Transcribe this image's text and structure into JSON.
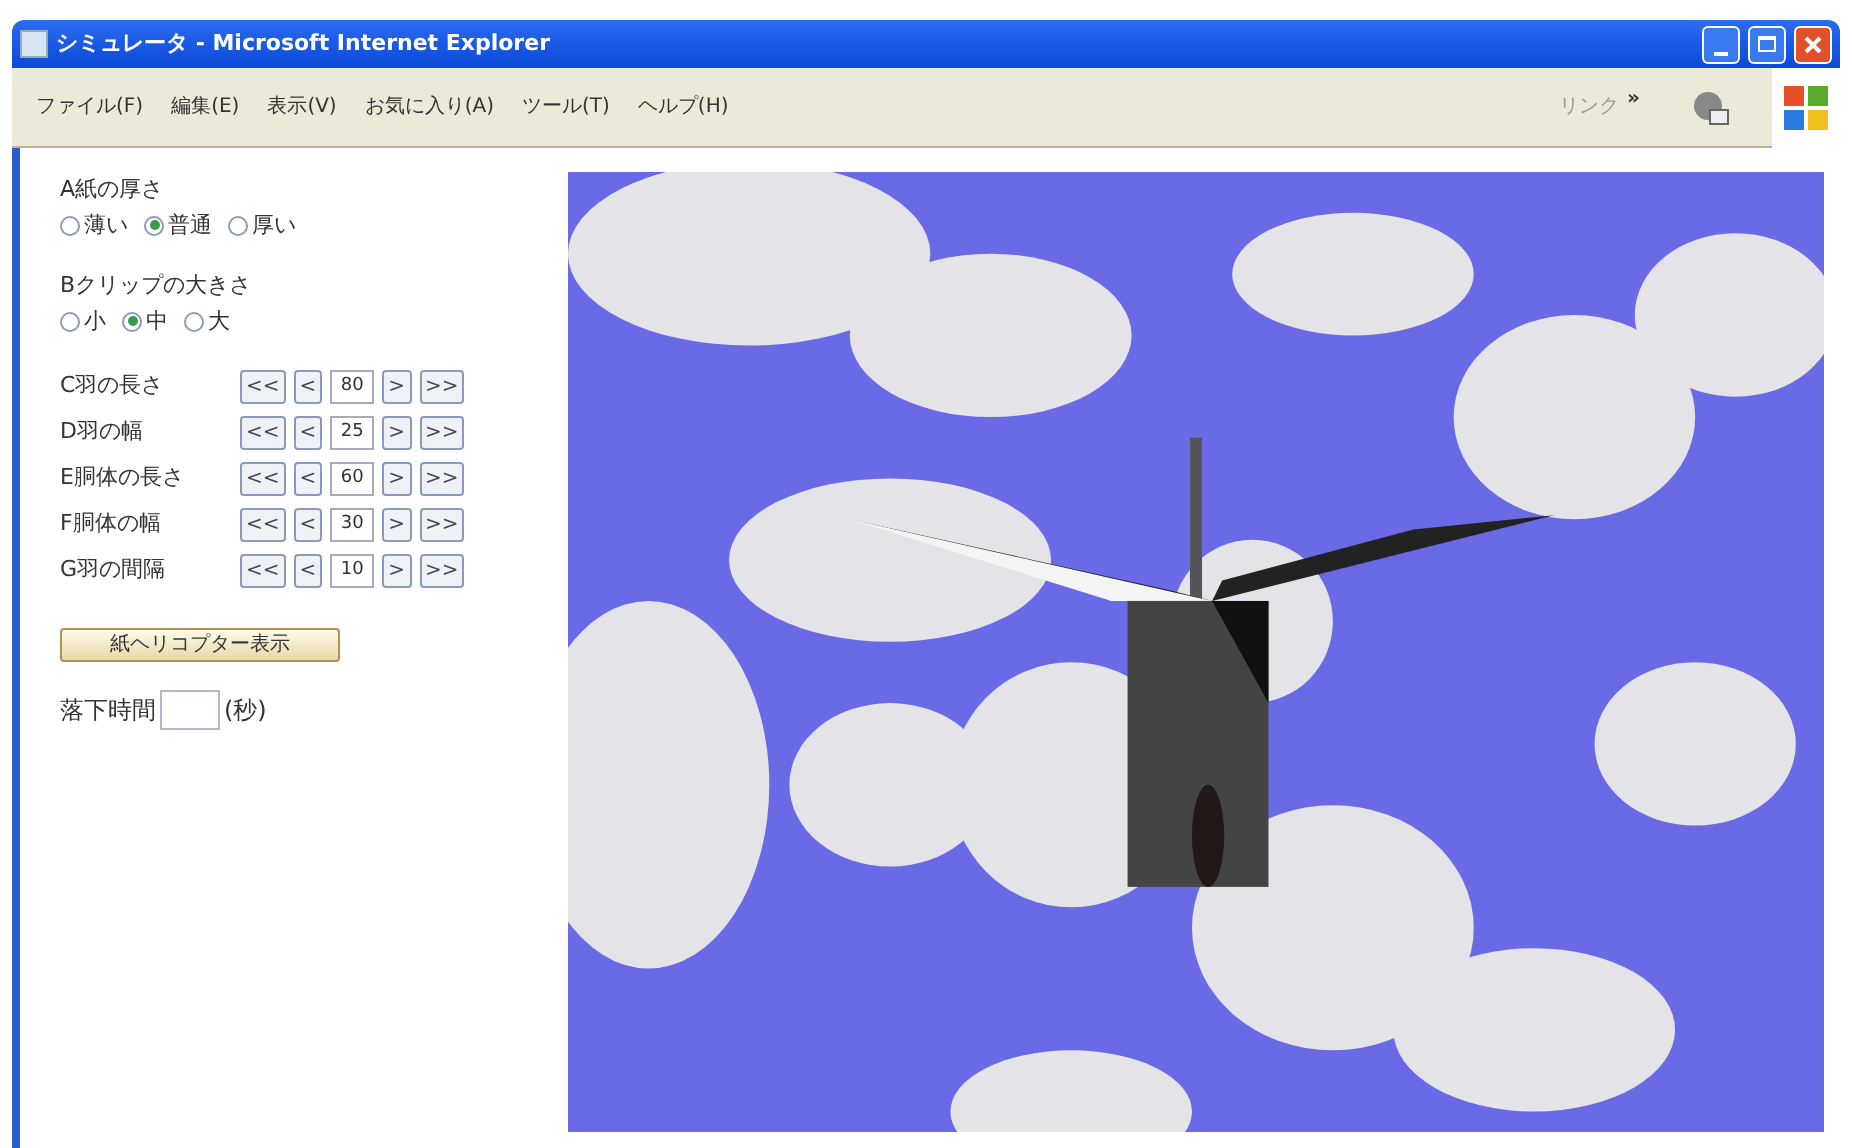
{
  "window": {
    "title": "シミュレータ - Microsoft Internet Explorer"
  },
  "menu": [
    "ファイル(F)",
    "編集(E)",
    "表示(V)",
    "お気に入り(A)",
    "ツール(T)",
    "ヘルプ(H)"
  ],
  "toolbar": {
    "links": "リンク",
    "more": "»"
  },
  "thickness": {
    "label": "A紙の厚さ",
    "options": [
      {
        "label": "薄い",
        "selected": false
      },
      {
        "label": "普通",
        "selected": true
      },
      {
        "label": "厚い",
        "selected": false
      }
    ]
  },
  "clip": {
    "label": "Bクリップの大きさ",
    "options": [
      {
        "label": "小",
        "selected": false
      },
      {
        "label": "中",
        "selected": true
      },
      {
        "label": "大",
        "selected": false
      }
    ]
  },
  "params": [
    {
      "label": "C羽の長さ",
      "value": "80"
    },
    {
      "label": "D羽の幅",
      "value": "25"
    },
    {
      "label": "E胴体の長さ",
      "value": "60"
    },
    {
      "label": "F胴体の幅",
      "value": "30"
    },
    {
      "label": "G羽の間隔",
      "value": "10"
    }
  ],
  "stepper": {
    "fast_back": "<<",
    "back": "<",
    "forward": ">",
    "fast_forward": ">>"
  },
  "show_button": "紙ヘリコプター表示",
  "fall_time": {
    "label": "落下時間",
    "unit": "(秒)"
  }
}
